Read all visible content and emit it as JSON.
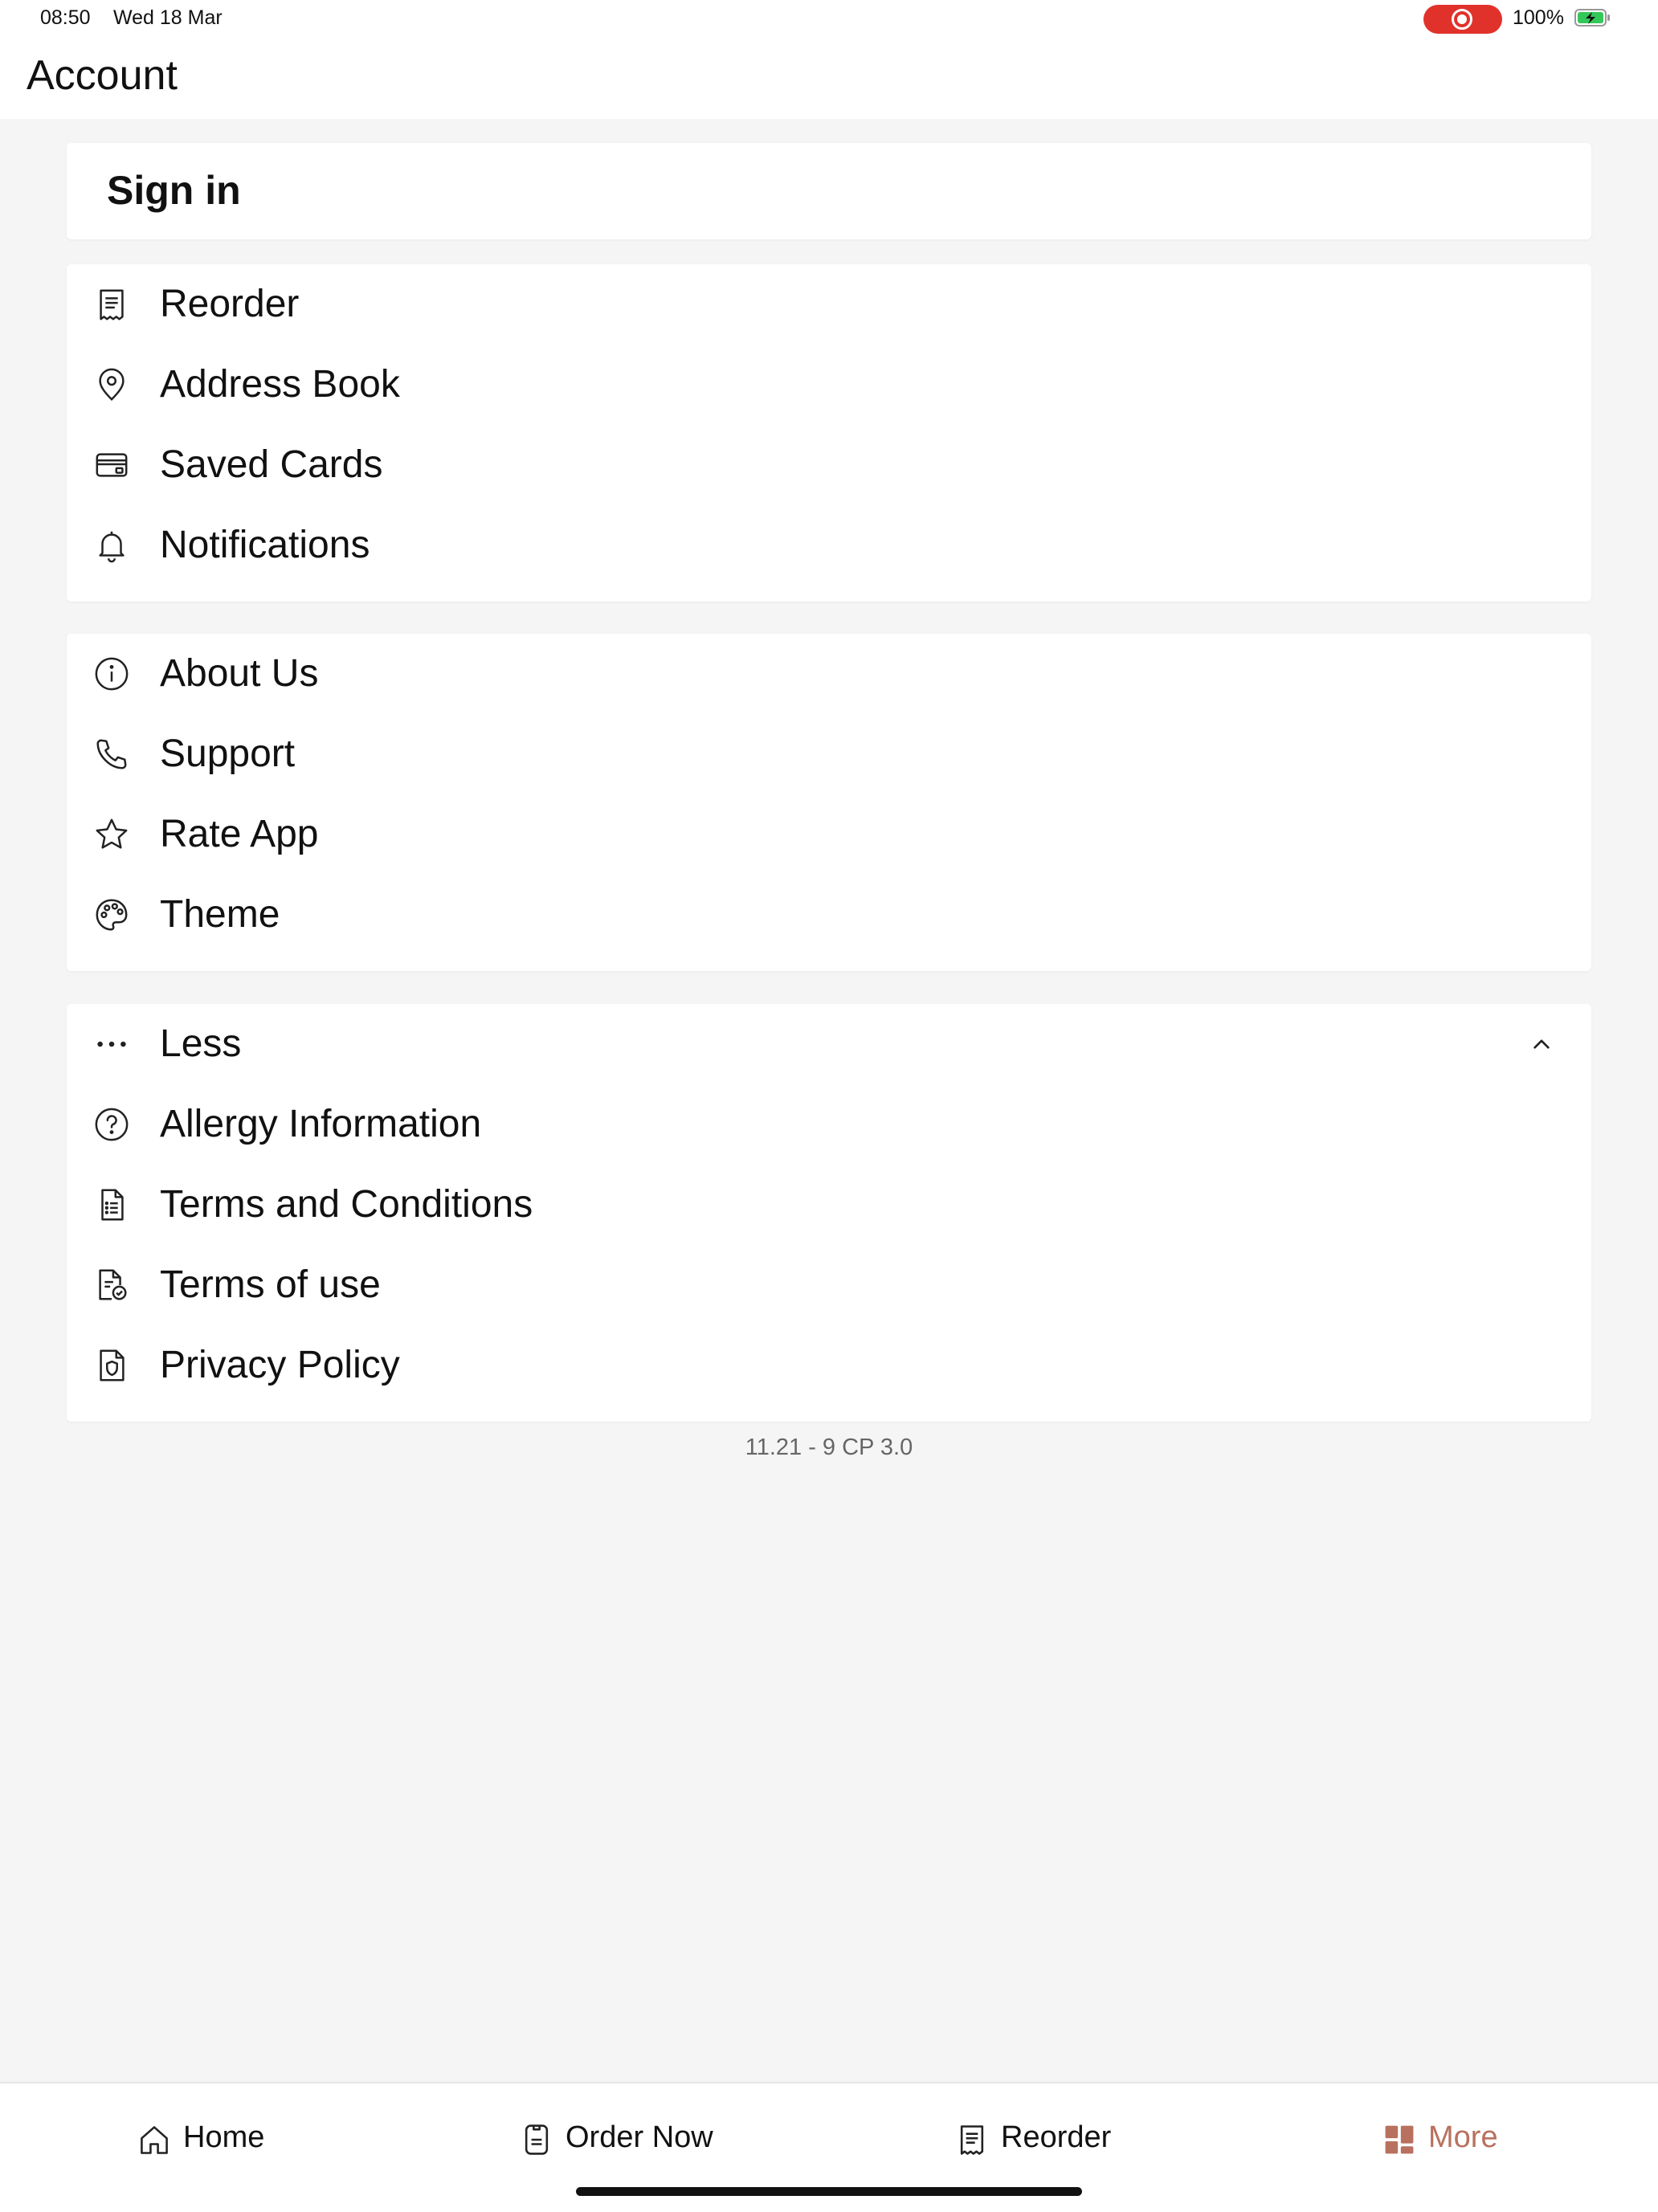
{
  "status_bar": {
    "time": "08:50",
    "date": "Wed 18 Mar",
    "battery": "100%"
  },
  "header": {
    "title": "Account"
  },
  "signin": {
    "label": "Sign in"
  },
  "account_menu": [
    {
      "label": "Reorder",
      "icon": "receipt-icon"
    },
    {
      "label": "Address Book",
      "icon": "map-pin-icon"
    },
    {
      "label": "Saved Cards",
      "icon": "credit-card-icon"
    },
    {
      "label": "Notifications",
      "icon": "bell-icon"
    }
  ],
  "info_menu": [
    {
      "label": "About Us",
      "icon": "info-icon"
    },
    {
      "label": "Support",
      "icon": "phone-icon"
    },
    {
      "label": "Rate App",
      "icon": "star-icon"
    },
    {
      "label": "Theme",
      "icon": "palette-icon"
    }
  ],
  "less_menu": {
    "toggle_label": "Less",
    "toggle_icon": "more-dots-icon",
    "items": [
      {
        "label": "Allergy Information",
        "icon": "help-circle-icon"
      },
      {
        "label": "Terms and Conditions",
        "icon": "document-list-icon"
      },
      {
        "label": "Terms of use",
        "icon": "document-check-icon"
      },
      {
        "label": "Privacy Policy",
        "icon": "shield-document-icon"
      }
    ]
  },
  "version": "11.21 - 9 CP 3.0",
  "tabbar": {
    "items": [
      {
        "label": "Home",
        "icon": "home-icon",
        "active": false
      },
      {
        "label": "Order Now",
        "icon": "order-icon",
        "active": false
      },
      {
        "label": "Reorder",
        "icon": "receipt-icon",
        "active": false
      },
      {
        "label": "More",
        "icon": "grid-icon",
        "active": true
      }
    ]
  },
  "colors": {
    "accent": "#b8715e",
    "record": "#e0322b",
    "background": "#f5f5f5"
  }
}
